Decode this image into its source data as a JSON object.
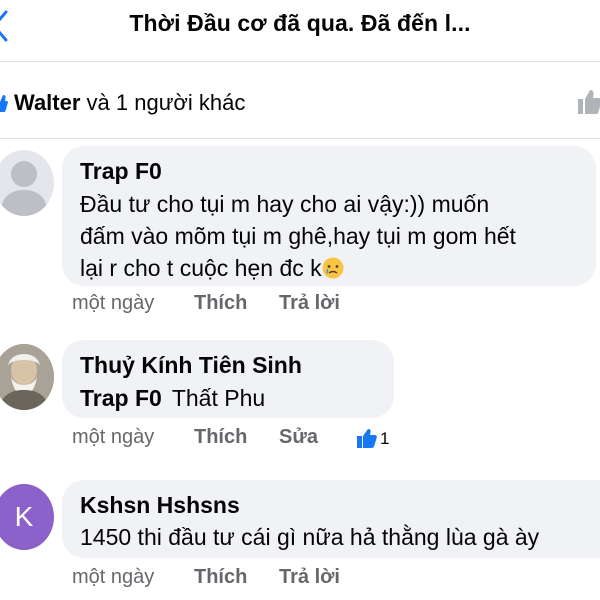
{
  "header": {
    "title": "Thời Đầu cơ đã qua. Đã đến l..."
  },
  "likes": {
    "name": "Walter",
    "rest": " và 1 người khác"
  },
  "comments": [
    {
      "author": "Trap F0",
      "lines": [
        "Đầu tư cho tụi m hay cho ai vậy:)) muốn",
        "đấm vào mõm tụi m ghê,hay tụi m gom hết",
        "lại r cho t cuộc hẹn đc k"
      ],
      "time": "một ngày",
      "like_label": "Thích",
      "reply_label": "Trả lời"
    },
    {
      "author": "Thuỷ Kính Tiên Sinh",
      "mention": "Trap F0",
      "text": "Thất Phu",
      "time": "một ngày",
      "like_label": "Thích",
      "edit_label": "Sửa",
      "reaction_count": "1"
    },
    {
      "avatar_letter": "K",
      "author": "Kshsn Hshsns",
      "text": "1450 thi đầu tư cái gì nữa hả thằng lùa gà ày",
      "time": "một ngày",
      "like_label": "Thích",
      "reply_label": "Trả lời"
    }
  ],
  "colors": {
    "accent": "#1877f2",
    "bubble": "#f0f2f5",
    "meta_text": "#65676b",
    "avatar_k": "#8c61c9"
  },
  "icons": {
    "back": "chevron-left-icon",
    "like": "thumbs-up-icon",
    "emoji": "crying-face-emoji"
  }
}
